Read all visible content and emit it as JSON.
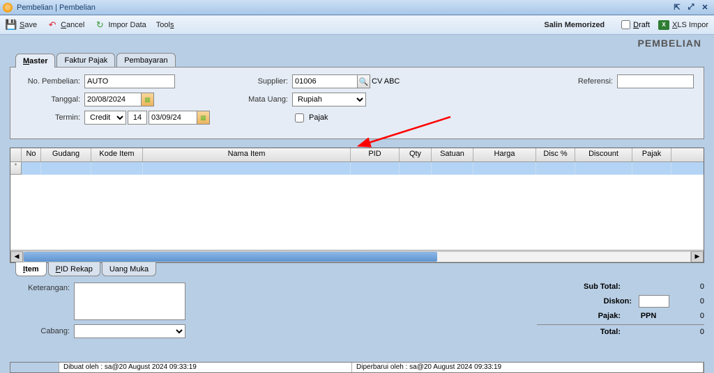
{
  "window": {
    "title": "Pembelian | Pembelian"
  },
  "toolbar": {
    "save": "Save",
    "cancel": "Cancel",
    "import_data": "Impor Data",
    "tools": "Tools",
    "salin_memorized": "Salin Memorized",
    "draft_label": "Draft",
    "xls_import": "XLS Impor"
  },
  "page_header": "PEMBELIAN",
  "tabs": {
    "top": [
      "Master",
      "Faktur Pajak",
      "Pembayaran"
    ],
    "bottom": [
      "Item",
      "PID Rekap",
      "Uang Muka"
    ]
  },
  "form": {
    "no_pembelian_label": "No. Pembelian:",
    "no_pembelian": "AUTO",
    "tanggal_label": "Tanggal:",
    "tanggal": "20/08/2024",
    "termin_label": "Termin:",
    "termin_type": "Credit",
    "termin_days": "14",
    "termin_due": "03/09/24",
    "supplier_label": "Supplier:",
    "supplier_code": "01006",
    "supplier_name": "CV ABC",
    "mata_uang_label": "Mata Uang:",
    "mata_uang": "Rupiah",
    "pajak_label": "Pajak",
    "referensi_label": "Referensi:",
    "referensi": ""
  },
  "grid": {
    "columns": [
      "No",
      "Gudang",
      "Kode Item",
      "Nama Item",
      "PID",
      "Qty",
      "Satuan",
      "Harga",
      "Disc %",
      "Discount",
      "Pajak",
      ""
    ]
  },
  "lower": {
    "keterangan_label": "Keterangan:",
    "keterangan": "",
    "cabang_label": "Cabang:",
    "cabang": ""
  },
  "totals": {
    "subtotal_label": "Sub Total:",
    "subtotal": "0",
    "diskon_label": "Diskon:",
    "diskon_pct": "",
    "diskon": "0",
    "pajak_label": "Pajak:",
    "pajak_name": "PPN",
    "pajak": "0",
    "total_label": "Total:",
    "total": "0"
  },
  "status": {
    "created": "Dibuat oleh : sa@20 August 2024  09:33:19",
    "updated": "Diperbarui oleh : sa@20 August 2024  09:33:19"
  }
}
